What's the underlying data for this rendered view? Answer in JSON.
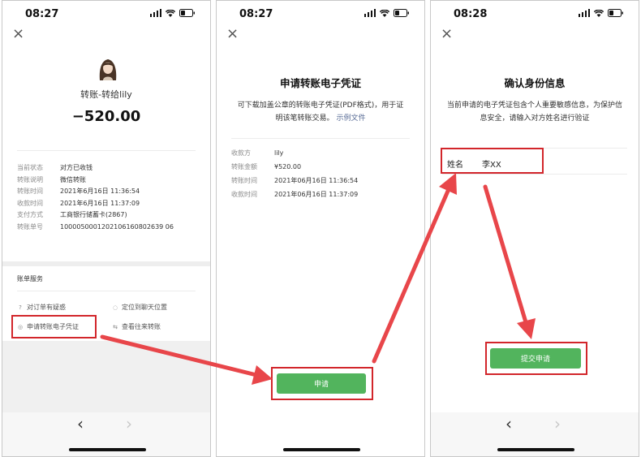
{
  "status_bars": [
    {
      "time": "08:27"
    },
    {
      "time": "08:27"
    },
    {
      "time": "08:28"
    }
  ],
  "close_glyph": "×",
  "screen1": {
    "title": "转账-转给lily",
    "amount": "−520.00",
    "details": [
      {
        "key": "当前状态",
        "value": "对方已收钱"
      },
      {
        "key": "转账说明",
        "value": "微信转账"
      },
      {
        "key": "转账时间",
        "value": "2021年6月16日 11:36:54"
      },
      {
        "key": "收款时间",
        "value": "2021年6月16日 11:37:09"
      },
      {
        "key": "支付方式",
        "value": "工商银行储蓄卡(2867)"
      },
      {
        "key": "转账单号",
        "value": "1000050001202106160802639 06"
      }
    ],
    "services_title": "账单服务",
    "services": {
      "question": {
        "icon": "?",
        "label": "对订单有疑惑"
      },
      "locate": {
        "icon": "◌",
        "label": "定位到聊天位置"
      },
      "voucher": {
        "icon": "◎",
        "label": "申请转账电子凭证"
      },
      "history": {
        "icon": "⇆",
        "label": "查看往来转账"
      }
    },
    "nav": {
      "back": "‹",
      "forward": "›"
    }
  },
  "screen2": {
    "title": "申请转账电子凭证",
    "desc_text": "可下载加盖公章的转账电子凭证(PDF格式)，用于证明该笔转账交易。",
    "desc_link": "示例文件",
    "details": [
      {
        "key": "收款方",
        "value": "lily"
      },
      {
        "key": "转账金额",
        "value": "¥520.00"
      },
      {
        "key": "转账时间",
        "value": "2021年06月16日 11:36:54"
      },
      {
        "key": "收款时间",
        "value": "2021年06月16日 11:37:09"
      }
    ],
    "apply_button": "申请"
  },
  "screen3": {
    "title": "确认身份信息",
    "desc_text": "当前申请的电子凭证包含个人重要敏感信息，为保护信息安全，请输入对方姓名进行验证",
    "name_label": "姓名",
    "name_value": "李XX",
    "submit_button": "提交申请",
    "nav": {
      "back": "‹",
      "forward": "›"
    }
  },
  "colors": {
    "accent_green": "#52b45d",
    "highlight_red": "#d2262b",
    "arrow_red": "#e8464a",
    "link_blue": "#576b95"
  }
}
